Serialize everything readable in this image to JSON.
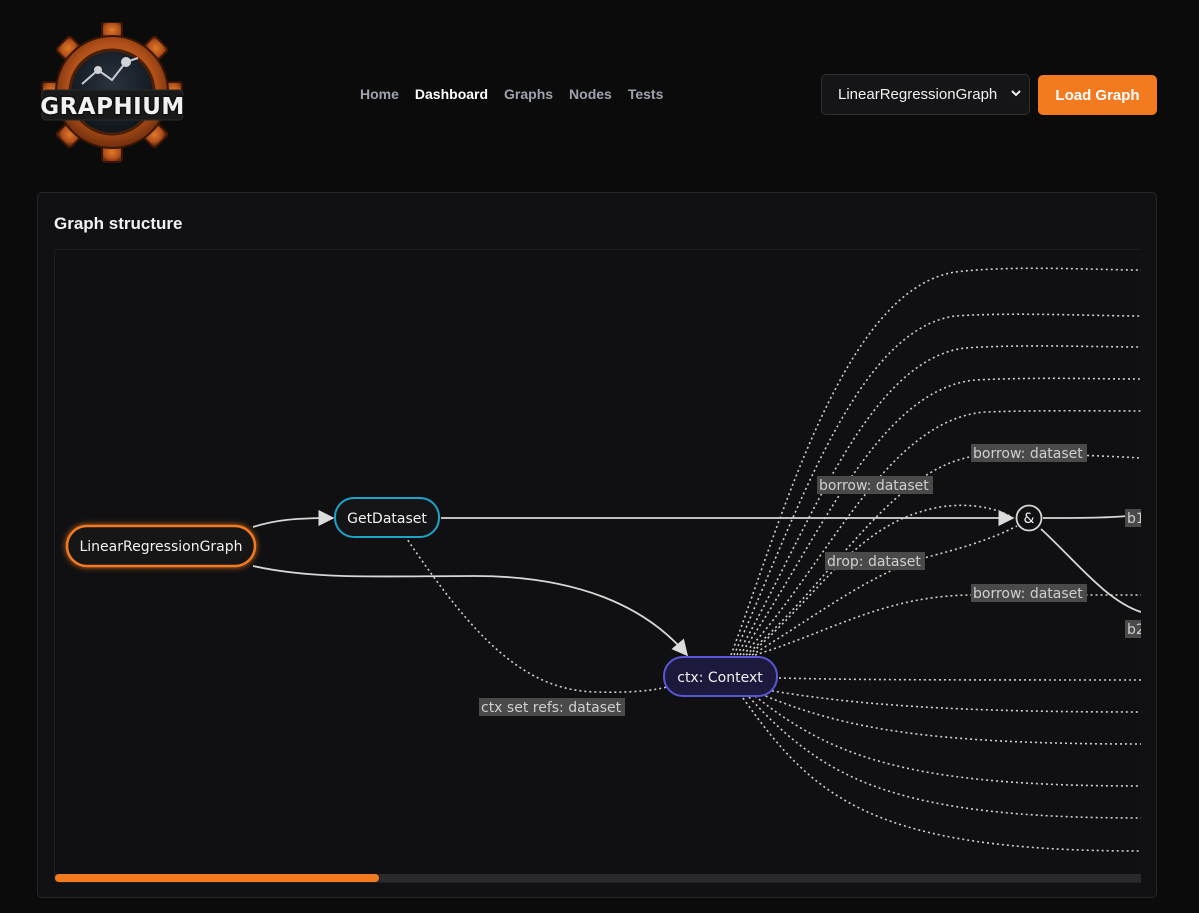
{
  "brand": {
    "logo_text": "GRAPHIUM"
  },
  "nav": {
    "items": [
      {
        "label": "Home",
        "active": false
      },
      {
        "label": "Dashboard",
        "active": true
      },
      {
        "label": "Graphs",
        "active": false
      },
      {
        "label": "Nodes",
        "active": false
      },
      {
        "label": "Tests",
        "active": false
      }
    ]
  },
  "toolbar": {
    "graph_select_value": "LinearRegressionGraph",
    "load_button_label": "Load Graph"
  },
  "panel": {
    "title": "Graph structure"
  },
  "graph": {
    "nodes": {
      "root": "LinearRegressionGraph",
      "get_dataset": "GetDataset",
      "ctx": "ctx: Context",
      "borrow_op": "&",
      "b1": "b1",
      "b2": "b2"
    },
    "edge_labels": {
      "ctx_set_refs": "ctx set refs: dataset",
      "borrow_1": "borrow: dataset",
      "borrow_2": "borrow: dataset",
      "drop": "drop: dataset",
      "borrow_3": "borrow: dataset"
    }
  },
  "colors": {
    "accent": "#f47a20",
    "node_root_border": "#f47a20",
    "node_dataset_border": "#1fa3c9",
    "node_context_border": "#5a55d6"
  }
}
